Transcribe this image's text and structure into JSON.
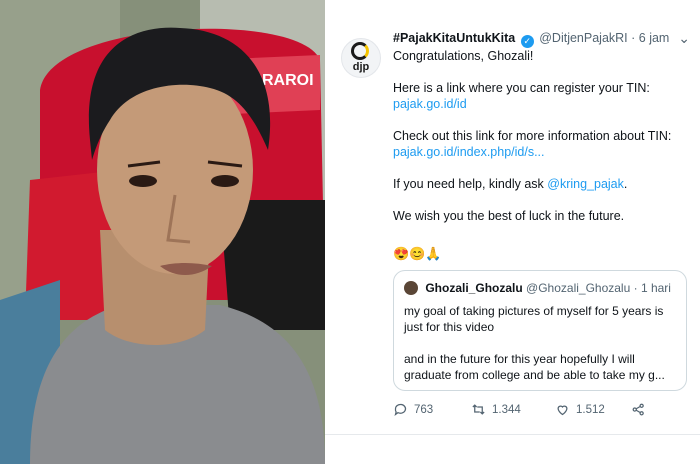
{
  "photo": {
    "chair_text": "RAROI"
  },
  "account": {
    "logo_text": "djp"
  },
  "tweet": {
    "hashtag": "#PajakKitaUntukKita",
    "handle": "@DitjenPajakRI",
    "time": "· 6 jam",
    "greeting": "Congratulations, Ghozali!",
    "line1": "Here is a link where you can register your TIN:",
    "link1": "pajak.go.id/id",
    "line2": "Check out this link for more information about TIN:",
    "link2": "pajak.go.id/index.php/id/s...",
    "help_prefix": "If you need help, kindly ask ",
    "help_mention": "@kring_pajak",
    "help_suffix": ".",
    "wish": "We wish you the best of luck in the future.",
    "emojis": "😍😊🙏"
  },
  "quoted": {
    "name": "Ghozali_Ghozalu",
    "handle": "@Ghozali_Ghozalu",
    "time": "· 1 hari",
    "text1": "my goal of taking pictures of myself for 5 years is just for this video",
    "text2": "and in the future for this year hopefully I will graduate from college and be able to take my g..."
  },
  "stats": {
    "replies": "763",
    "retweets": "1.344",
    "likes": "1.512"
  },
  "colors": {
    "accent": "#1d9bf0",
    "chair_red": "#c8102e"
  }
}
